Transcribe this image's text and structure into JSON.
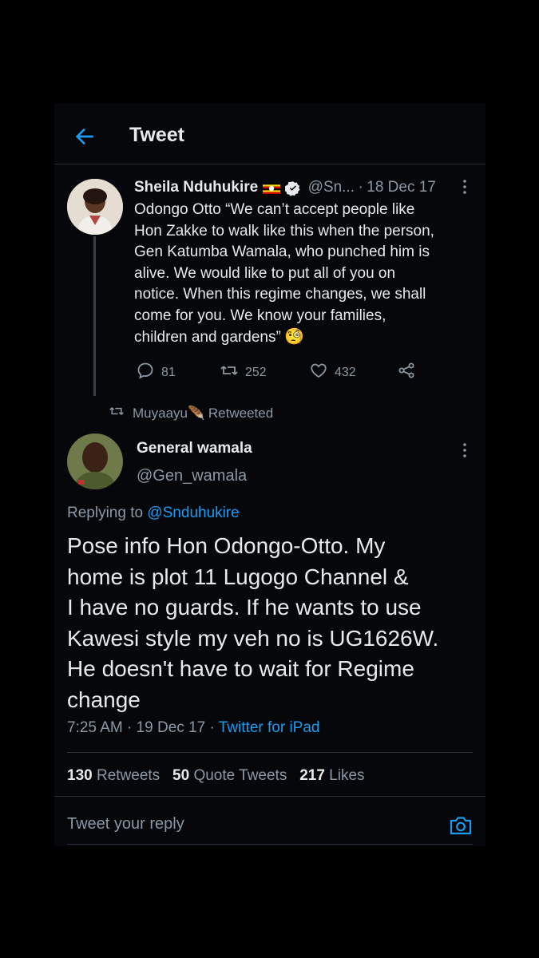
{
  "header": {
    "title": "Tweet"
  },
  "quoted_tweet": {
    "author_name": "Sheila Nduhukire",
    "handle": "@Sn...",
    "separator": "·",
    "date": "18 Dec 17",
    "text": "Odongo Otto “We can’t accept people like\nHon Zakke to walk like this when the person,\nGen Katumba Wamala, who punched him is\nalive. We would like to put all of you on\nnotice. When this regime changes, we shall\ncome for you. We know your families,\nchildren and gardens”",
    "emoji": "🧐",
    "replies": "81",
    "retweets": "252",
    "likes": "432"
  },
  "retweet_notice": {
    "user": "Muyaayu",
    "emoji": "🪶",
    "suffix": "Retweeted"
  },
  "main_tweet": {
    "author_name": "General wamala",
    "handle": "@Gen_wamala",
    "replying_prefix": "Replying to ",
    "replying_handle": "@Snduhukire",
    "text": "Pose info Hon Odongo-Otto. My\nhome is plot 11 Lugogo Channel &\nI have no guards. If he wants to use\nKawesi style my veh no is UG1626W.\nHe doesn't have to wait for Regime\nchange",
    "time": "7:25 AM",
    "separator": "·",
    "date": "19 Dec 17",
    "separator2": "·",
    "source": "Twitter for iPad"
  },
  "stats": {
    "retweets_count": "130",
    "retweets_label": "Retweets",
    "quotes_count": "50",
    "quotes_label": "Quote Tweets",
    "likes_count": "217",
    "likes_label": "Likes"
  },
  "reply_box": {
    "placeholder": "Tweet your reply"
  },
  "colors": {
    "background": "#05070a",
    "accent": "#1d9bf0",
    "muted": "#8b98a5",
    "text": "#e7e9ea",
    "divider": "#2a2f33"
  }
}
